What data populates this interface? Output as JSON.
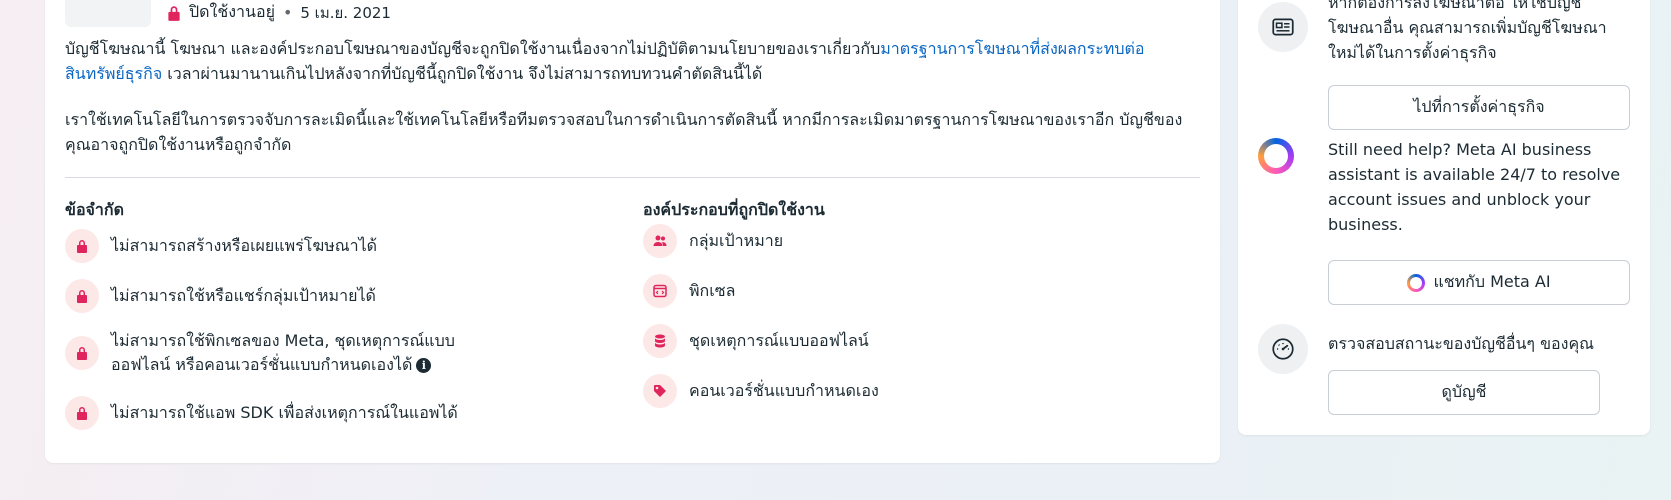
{
  "account": {
    "status": "ปิดใช้งานอยู่",
    "separator": "•",
    "date": "5 เม.ย. 2021"
  },
  "notice": {
    "p1_before": "บัญชีโฆษณานี้ โฆษณา และองค์ประกอบโฆษณาของบัญชีจะถูกปิดใช้งานเนื่องจากไม่ปฏิบัติตามนโยบายของเราเกี่ยวกับ",
    "p1_link": "มาตรฐานการโฆษณาที่ส่งผลกระทบต่อสินทรัพย์ธุรกิจ",
    "p1_after": " เวลาผ่านมานานเกินไปหลังจากที่บัญชีนี้ถูกปิดใช้งาน จึงไม่สามารถทบทวนคำตัดสินนี้ได้",
    "p2": "เราใช้เทคโนโลยีในการตรวจจับการละเมิดนี้และใช้เทคโนโลยีหรือทีมตรวจสอบในการดำเนินการตัดสินนี้ หากมีการละเมิดมาตรฐานการโฆษณาของเราอีก บัญชีของคุณอาจถูกปิดใช้งานหรือถูกจำกัด"
  },
  "restrictions": {
    "title": "ข้อจำกัด",
    "items": [
      {
        "icon": "lock-icon",
        "label": "ไม่สามารถสร้างหรือเผยแพร่โฆษณาได้"
      },
      {
        "icon": "lock-icon",
        "label": "ไม่สามารถใช้หรือแชร์กลุ่มเป้าหมายได้"
      },
      {
        "icon": "lock-icon",
        "label_line1": "ไม่สามารถใช้พิกเซลของ Meta, ชุดเหตุการณ์แบบ",
        "label_line2": "ออฟไลน์ หรือคอนเวอร์ชั่นแบบกำหนดเองได้",
        "info": "i"
      },
      {
        "icon": "lock-icon",
        "label": "ไม่สามารถใช้แอพ SDK เพื่อส่งเหตุการณ์ในแอพได้"
      }
    ]
  },
  "disabled_assets": {
    "title": "องค์ประกอบที่ถูกปิดใช้งาน",
    "items": [
      {
        "icon": "people-icon",
        "label": "กลุ่มเป้าหมาย"
      },
      {
        "icon": "pixel-icon",
        "label": "พิกเซล"
      },
      {
        "icon": "database-icon",
        "label": "ชุดเหตุการณ์แบบออฟไลน์"
      },
      {
        "icon": "tag-icon",
        "label": "คอนเวอร์ชั่นแบบกำหนดเอง"
      }
    ]
  },
  "sidebar": {
    "section1_text": "หากต้องการลงโฆษณาต่อ ให้ใช้บัญชีโฆษณาอื่น คุณสามารถเพิ่มบัญชีโฆษณาใหม่ได้ในการตั้งค่าธุรกิจ",
    "section1_button": "ไปที่การตั้งค่าธุรกิจ",
    "section2_text": "Still need help? Meta AI business assistant is available 24/7 to resolve account issues and unblock your business.",
    "section2_button": "แชทกับ Meta AI",
    "section3_text": "ตรวจสอบสถานะของบัญชีอื่นๆ ของคุณ",
    "section3_button": "ดูบัญชี"
  },
  "colors": {
    "link": "#0a66c2",
    "danger": "#e0245e",
    "danger_bg": "#fde8e8"
  }
}
